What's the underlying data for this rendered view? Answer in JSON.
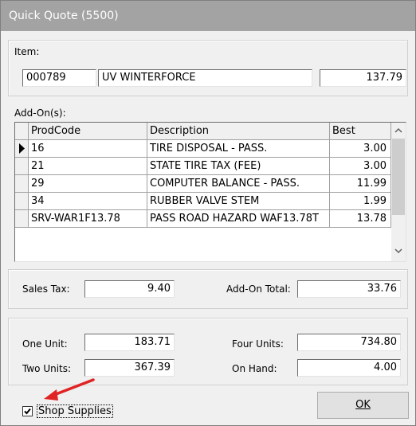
{
  "window": {
    "title": "Quick Quote (5500)"
  },
  "item": {
    "label": "Item:",
    "code": "000789",
    "name": "UV WINTERFORCE",
    "price": "137.79"
  },
  "addons": {
    "label": "Add-On(s):",
    "columns": [
      "ProdCode",
      "Description",
      "Best"
    ],
    "rows": [
      {
        "code": "16",
        "description": "TIRE DISPOSAL - PASS.",
        "best": "3.00"
      },
      {
        "code": "21",
        "description": "STATE TIRE TAX (FEE)",
        "best": "3.00"
      },
      {
        "code": "29",
        "description": "COMPUTER BALANCE - PASS.",
        "best": "11.99"
      },
      {
        "code": "34",
        "description": "RUBBER VALVE STEM",
        "best": "1.99"
      },
      {
        "code": "SRV-WAR1F13.78",
        "description": "PASS ROAD HAZARD WAF13.78T",
        "best": "13.78"
      }
    ]
  },
  "totals": {
    "sales_tax_label": "Sales Tax:",
    "sales_tax": "9.40",
    "addon_total_label": "Add-On Total:",
    "addon_total": "33.76"
  },
  "units": {
    "one_label": "One Unit:",
    "one": "183.71",
    "two_label": "Two Units:",
    "two": "367.39",
    "four_label": "Four Units:",
    "four": "734.80",
    "onhand_label": "On Hand:",
    "onhand": "4.00"
  },
  "shop_supplies": {
    "label": "Shop Supplies",
    "checked": true
  },
  "ok_button": {
    "label": "OK"
  },
  "colors": {
    "annotation_arrow": "#e02424"
  }
}
